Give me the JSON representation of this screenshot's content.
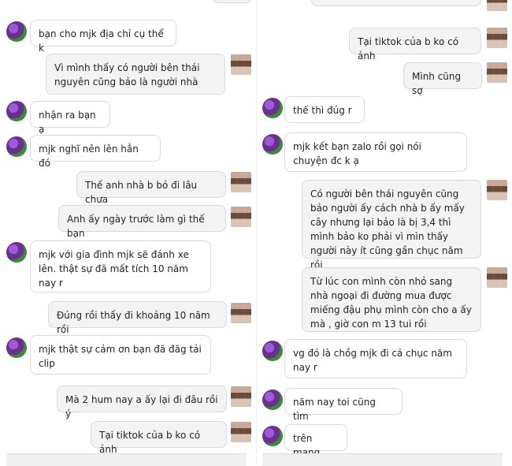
{
  "left": {
    "top_partial": "",
    "messages": [
      {
        "side": "other",
        "text": "bạn cho mjk địa chỉ cụ thể k"
      },
      {
        "side": "me",
        "text": "Vì mình thấy có người bên thái nguyên cũng bảo là người nhà"
      },
      {
        "side": "other",
        "text": "nhận ra bạn ạ"
      },
      {
        "side": "other",
        "text": "mjk nghĩ nên lên hẳn đó"
      },
      {
        "side": "me",
        "text": "Thế anh nhà b bỏ đi lâu chưa"
      },
      {
        "side": "me",
        "text": "Anh ấy ngày trước làm gì thế bạn"
      },
      {
        "side": "other",
        "text": "mjk với gia đình mjk sẽ đánh xe lên. thật sự đã mất tích 10 năm nay r"
      },
      {
        "side": "me",
        "text": "Đúng rồi thấy đi khoảng 10 năm rồi"
      },
      {
        "side": "other",
        "text": "mjk thật sự cảm ơn bạn đã đăg tải clip"
      },
      {
        "side": "me",
        "text": "Mà 2 hum nay a ấy lại đi đâu rồi ý"
      },
      {
        "side": "me",
        "text": "Tại tiktok của b ko có ảnh"
      }
    ]
  },
  "right": {
    "messages": [
      {
        "side": "me",
        "text": "Tại tiktok của b ko có ảnh"
      },
      {
        "side": "me",
        "text": "Mình cũng sợ"
      },
      {
        "side": "other",
        "text": "thế thì đúg r"
      },
      {
        "side": "other",
        "text": "mjk kết bạn zalo rồi gọi nói chuyện đc k ạ"
      },
      {
        "side": "me",
        "text": "Có người bên thái nguyên cũng bảo người ấy cách nhà b ấy mấy cây nhưng lại bảo là bị 3,4 thì mình bảo ko phải vì mìn thấy người này ít cũng gần chục năm rồi"
      },
      {
        "side": "me",
        "text": "Từ lúc con mình còn nhỏ sang nhà ngoại đi đường mua được miếng đậu phụ mình còn cho a ấy mà , giờ con m 13 tui rồi"
      },
      {
        "side": "other",
        "text": "vg đó là chồg mjk đi cả chục năm nay r"
      },
      {
        "side": "other",
        "text": "năm nay toi cũng tìm"
      },
      {
        "side": "other",
        "text": "trên mạng"
      }
    ]
  }
}
